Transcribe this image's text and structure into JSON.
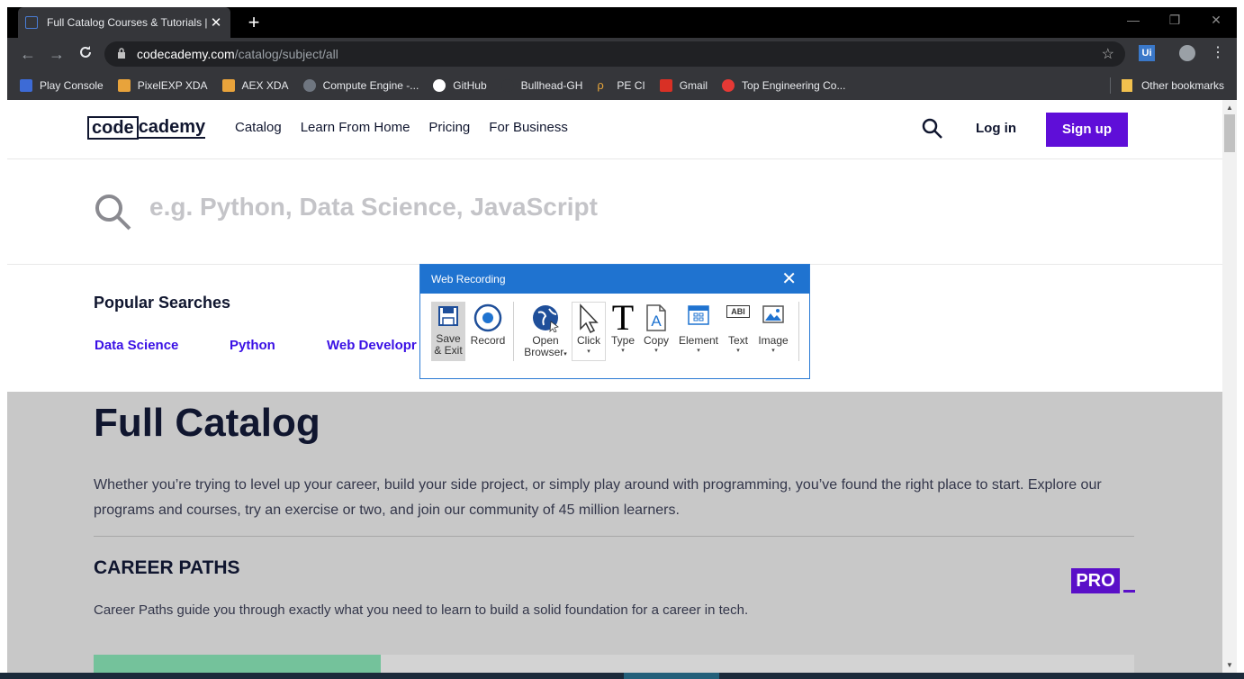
{
  "browser": {
    "tab_title": "Full Catalog Courses & Tutorials |",
    "tab_close": "✕",
    "new_tab": "+",
    "win_minimize": "—",
    "win_restore": "❐",
    "win_close": "✕",
    "url_host": "codecademy.com",
    "url_path": "/catalog/subject/all",
    "bookmarks": [
      {
        "label": "Play Console",
        "color": "#3d6bd6"
      },
      {
        "label": "PixelEXP XDA",
        "color": "#e8a33b"
      },
      {
        "label": "AEX XDA",
        "color": "#e8a33b"
      },
      {
        "label": "Compute Engine -...",
        "color": "#6f7680"
      },
      {
        "label": "GitHub",
        "color": "#ffffff"
      },
      {
        "label": "Bullhead-GH",
        "color": "#35363a"
      },
      {
        "label": "PE CI",
        "color": "#e2a23a"
      },
      {
        "label": "Gmail",
        "color": "#d93025"
      },
      {
        "label": "Top Engineering Co...",
        "color": "#e53935"
      }
    ],
    "other_bookmarks": "Other bookmarks"
  },
  "site": {
    "logo_box": "code",
    "logo_rest": "cademy",
    "nav": [
      "Catalog",
      "Learn From Home",
      "Pricing",
      "For Business"
    ],
    "login": "Log in",
    "signup": "Sign up",
    "search_placeholder": "e.g. Python, Data Science, JavaScript",
    "popular_title": "Popular Searches",
    "popular_links": [
      "Data Science",
      "Python",
      "Web Developr"
    ],
    "heading": "Full Catalog",
    "description": "Whether you’re trying to level up your career, build your side project, or simply play around with programming, you’ve found the right place to start. Explore our programs and courses, try an exercise or two, and join our community of 45 million learners.",
    "career_title": "CAREER PATHS",
    "pro_badge": "PRO",
    "career_desc": "Career Paths guide you through exactly what you need to learn to build a solid foundation for a career in tech.",
    "accent_color": "#5f0ed8"
  },
  "recorder": {
    "title": "Web Recording",
    "close": "✕",
    "tools": [
      {
        "label1": "Save",
        "label2": "& Exit",
        "icon": "save-icon"
      },
      {
        "label1": "Record",
        "label2": "",
        "icon": "record-icon"
      },
      {
        "label1": "Open",
        "label2": "Browser",
        "icon": "globe-icon"
      },
      {
        "label1": "Click",
        "label2": "",
        "icon": "cursor-icon"
      },
      {
        "label1": "Type",
        "label2": "",
        "icon": "type-icon"
      },
      {
        "label1": "Copy",
        "label2": "",
        "icon": "copy-icon"
      },
      {
        "label1": "Element",
        "label2": "",
        "icon": "element-icon"
      },
      {
        "label1": "Text",
        "label2": "",
        "icon": "text-icon"
      },
      {
        "label1": "Image",
        "label2": "",
        "icon": "image-icon"
      }
    ],
    "dropdown": "▾",
    "text_icon_glyph": "ABI",
    "type_icon_glyph": "T",
    "copy_icon_glyph": "A"
  }
}
